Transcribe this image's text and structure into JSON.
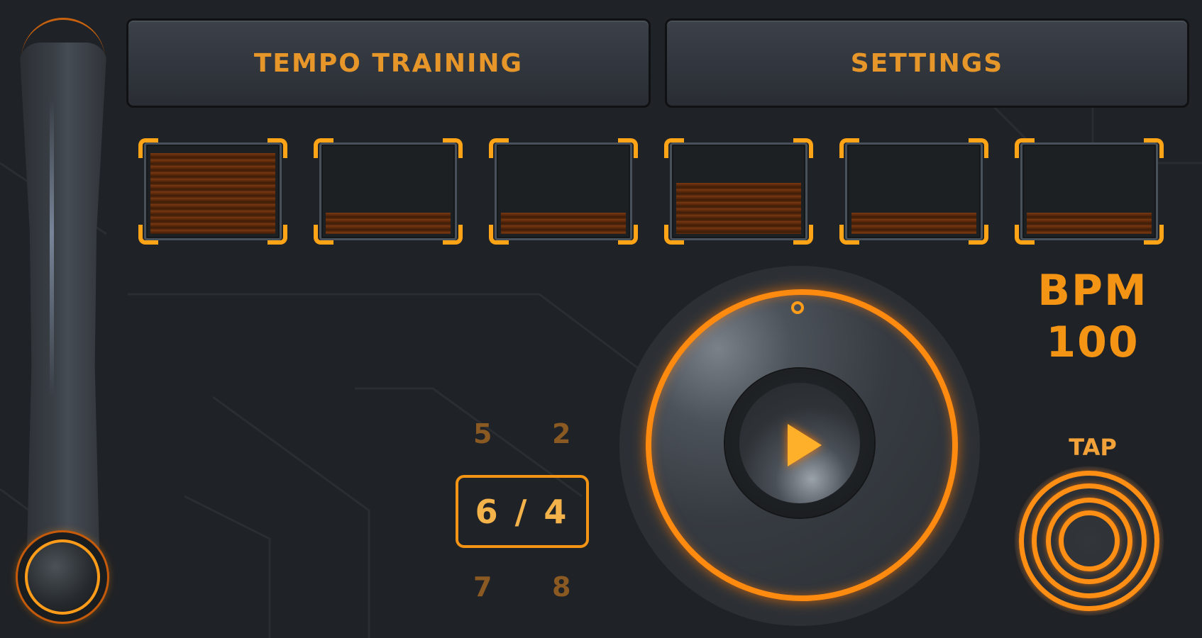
{
  "buttons": {
    "tempo_training": "TEMPO TRAINING",
    "settings": "SETTINGS"
  },
  "beats": [
    {
      "level": 0.95,
      "accent": "strong"
    },
    {
      "level": 0.25,
      "accent": "weak"
    },
    {
      "level": 0.25,
      "accent": "weak"
    },
    {
      "level": 0.6,
      "accent": "medium"
    },
    {
      "level": 0.25,
      "accent": "weak"
    },
    {
      "level": 0.25,
      "accent": "weak"
    }
  ],
  "bpm": {
    "label": "BPM",
    "value": "100"
  },
  "time_signature": {
    "current": "6 / 4",
    "options": {
      "top_left": "5",
      "top_right": "2",
      "bottom_left": "7",
      "bottom_right": "8"
    }
  },
  "tap": {
    "label": "TAP"
  },
  "colors": {
    "accent": "#ff9d1a",
    "background": "#1f2226",
    "beat_fill": "#6a3210"
  },
  "icons": {
    "play": "play-icon",
    "tap": "tap-target-icon"
  }
}
